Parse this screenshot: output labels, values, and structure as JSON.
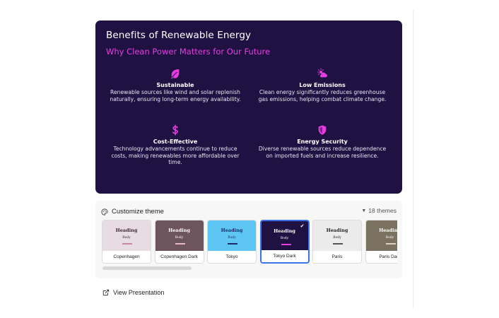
{
  "slide": {
    "title": "Benefits of Renewable Energy",
    "subtitle": "Why Clean Power Matters for Our Future",
    "features": [
      {
        "icon": "leaf-icon",
        "title": "Sustainable",
        "lines": [
          "Renewable sources like wind and solar replenish",
          "naturally, ensuring long-term energy availability."
        ]
      },
      {
        "icon": "sun-cloud-icon",
        "title": "Low Emissions",
        "lines": [
          "Clean energy significantly reduces greenhouse",
          "gas emissions, helping combat climate change."
        ]
      },
      {
        "icon": "dollar-icon",
        "title": "Cost-Effective",
        "lines": [
          "Technology advancements continue to reduce",
          "costs, making renewables more affordable over",
          "time."
        ]
      },
      {
        "icon": "shield-icon",
        "title": "Energy Security",
        "lines": [
          "Diverse renewable sources reduce dependence",
          "on imported fuels and increase resilience."
        ]
      }
    ],
    "colors": {
      "background": "#1f1243",
      "accent": "#e53de0"
    }
  },
  "theme_panel": {
    "title": "Customize theme",
    "count_label": "18 themes",
    "themes": [
      {
        "name": "Copenhagen",
        "heading": "Heading",
        "body": "Body",
        "bg": "#e6dce1",
        "text": "#3d2a33",
        "line": "#c98aa0",
        "selected": false
      },
      {
        "name": "Copenhagen Dark",
        "heading": "Heading",
        "body": "Body",
        "bg": "#6d545d",
        "text": "#ffffff",
        "line": "#e3b9c5",
        "selected": false
      },
      {
        "name": "Tokyo",
        "heading": "Heading",
        "body": "Body",
        "bg": "#5ec6f3",
        "text": "#1c2a6b",
        "line": "#1c2a6b",
        "selected": false
      },
      {
        "name": "Tokyo Dark",
        "heading": "Heading",
        "body": "Body",
        "bg": "#1f1243",
        "text": "#ffffff",
        "line": "#e53de0",
        "selected": true
      },
      {
        "name": "Paris",
        "heading": "Heading",
        "body": "Body",
        "bg": "#ebebeb",
        "text": "#222222",
        "line": "#555555",
        "selected": false
      },
      {
        "name": "Paris Dark",
        "heading": "Heading",
        "body": "Body",
        "bg": "#7a7160",
        "text": "#ffffff",
        "line": "#d9d2c2",
        "selected": false
      }
    ],
    "selected_color": "#3a73e8"
  },
  "view_presentation": {
    "label": "View Presentation",
    "icon": "external-link-icon"
  }
}
